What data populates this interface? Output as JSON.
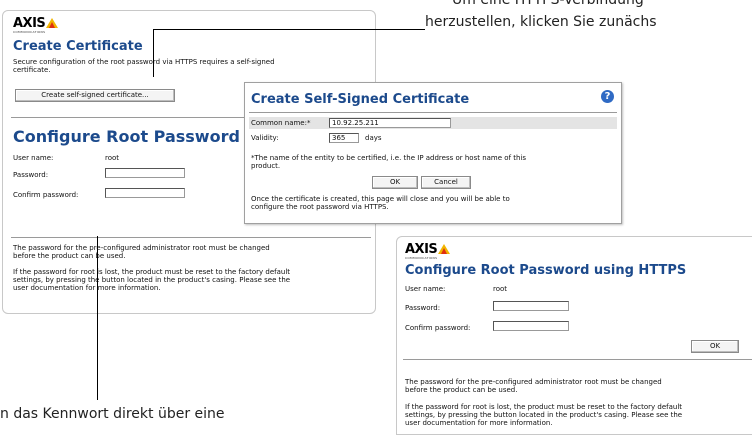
{
  "callouts": {
    "top_right_line1": "Um eine HTTPS-Verbindung",
    "top_right_line2": "herzustellen, klicken Sie zunächs",
    "bottom_left": "n das Kennwort direkt über eine"
  },
  "panel_main": {
    "logo": "AXIS",
    "logo_sub": "COMMUNICATIONS",
    "create_cert_title": "Create Certificate",
    "create_cert_desc_1": "Secure configuration of the root password via HTTPS requires a self-signed",
    "create_cert_desc_2": "certificate.",
    "create_cert_button": "Create self-signed certificate...",
    "root_title": "Configure Root Password",
    "user_label": "User name:",
    "user_value": "root",
    "password_label": "Password:",
    "confirm_label": "Confirm password:",
    "note_1": "The password for the pre-configured administrator root must be changed",
    "note_2": "before the product can be used.",
    "lost_1": "If the password for root is lost, the product must be reset to the factory default",
    "lost_2": "settings, by pressing the button located in the product's casing. Please see the",
    "lost_3": "user documentation for more information."
  },
  "dialog": {
    "title": "Create Self-Signed Certificate",
    "help": "?",
    "common_name_label": "Common name:*",
    "common_name_value": "10.92.25.211",
    "validity_label": "Validity:",
    "validity_value": "365",
    "validity_unit": "days",
    "footnote_1": "*The name of the entity to be certified, i.e. the IP address or host name of this",
    "footnote_2": "product.",
    "ok": "OK",
    "cancel": "Cancel",
    "info_1": "Once the certificate is created, this page will close and you will be able to",
    "info_2": "configure the root password via HTTPS."
  },
  "panel_https": {
    "logo": "AXIS",
    "logo_sub": "COMMUNICATIONS",
    "title": "Configure Root Password using HTTPS",
    "user_label": "User name:",
    "user_value": "root",
    "password_label": "Password:",
    "confirm_label": "Confirm password:",
    "ok": "OK",
    "note_1": "The password for the pre-configured administrator root must be changed",
    "note_2": "before the product can be used.",
    "lost_1": "If the password for root is lost, the product must be reset to the factory default",
    "lost_2": "settings, by pressing the button located in the product's casing. Please see the",
    "lost_3": "user documentation for more information."
  }
}
